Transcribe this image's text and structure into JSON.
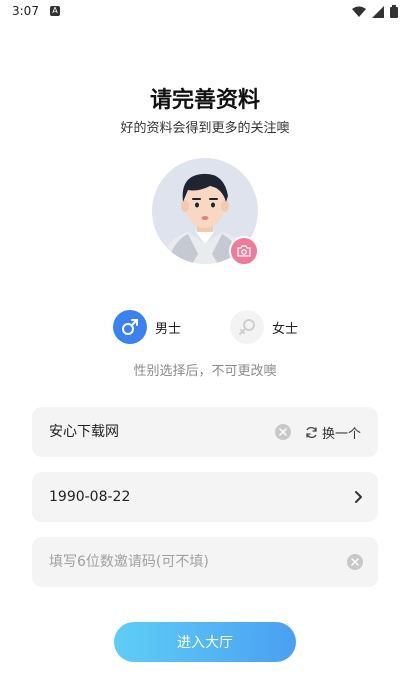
{
  "status_bar": {
    "time": "3:07",
    "notification_icon": "A",
    "icons": [
      "wifi-icon",
      "signal-icon",
      "battery-icon"
    ]
  },
  "header": {
    "title": "请完善资料",
    "subtitle": "好的资料会得到更多的关注噢"
  },
  "avatar": {
    "icon": "camera-icon",
    "camera_color": "#f07a9c"
  },
  "gender": {
    "male_label": "男士",
    "female_label": "女士",
    "selected": "male",
    "hint": "性别选择后，不可更改噢",
    "male_color": "#3b82f0"
  },
  "form": {
    "nickname": "安心下载网",
    "swap_label": "换一个",
    "birthday": "1990-08-22",
    "invite_code_value": "",
    "invite_code_placeholder": "填写6位数邀请码(可不填)"
  },
  "enter_button": {
    "label": "进入大厅"
  }
}
